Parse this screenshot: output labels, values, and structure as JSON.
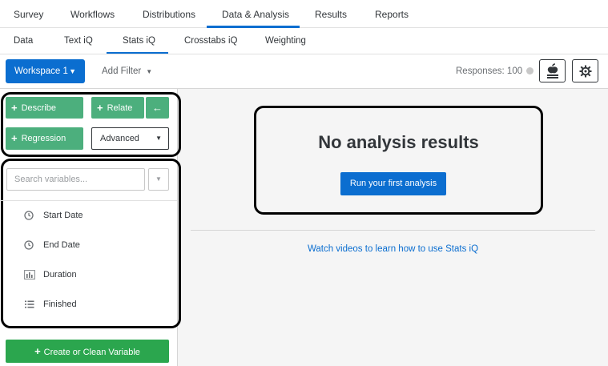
{
  "top_nav": {
    "tabs": [
      "Survey",
      "Workflows",
      "Distributions",
      "Data & Analysis",
      "Results",
      "Reports"
    ],
    "active": "Data & Analysis"
  },
  "sub_nav": {
    "tabs": [
      "Data",
      "Text iQ",
      "Stats iQ",
      "Crosstabs iQ",
      "Weighting"
    ],
    "active": "Stats iQ"
  },
  "toolbar": {
    "workspace_label": "Workspace 1",
    "add_filter_label": "Add Filter",
    "responses_label": "Responses: 100"
  },
  "sidebar": {
    "describe_label": "Describe",
    "relate_label": "Relate",
    "relate_arrow": "←",
    "regression_label": "Regression",
    "advanced_label": "Advanced",
    "search_placeholder": "Search variables...",
    "variables": [
      {
        "label": "Start Date",
        "icon": "clock-icon"
      },
      {
        "label": "End Date",
        "icon": "clock-icon"
      },
      {
        "label": "Duration",
        "icon": "bar-chart-icon"
      },
      {
        "label": "Finished",
        "icon": "list-icon"
      }
    ],
    "create_label": "Create or Clean Variable"
  },
  "main": {
    "heading": "No analysis results",
    "run_button": "Run your first analysis",
    "watch_link": "Watch videos to learn how to use Stats iQ"
  },
  "colors": {
    "accent_blue": "#0b6ed0",
    "green": "#4caf7d",
    "create_green": "#2ba64e"
  }
}
